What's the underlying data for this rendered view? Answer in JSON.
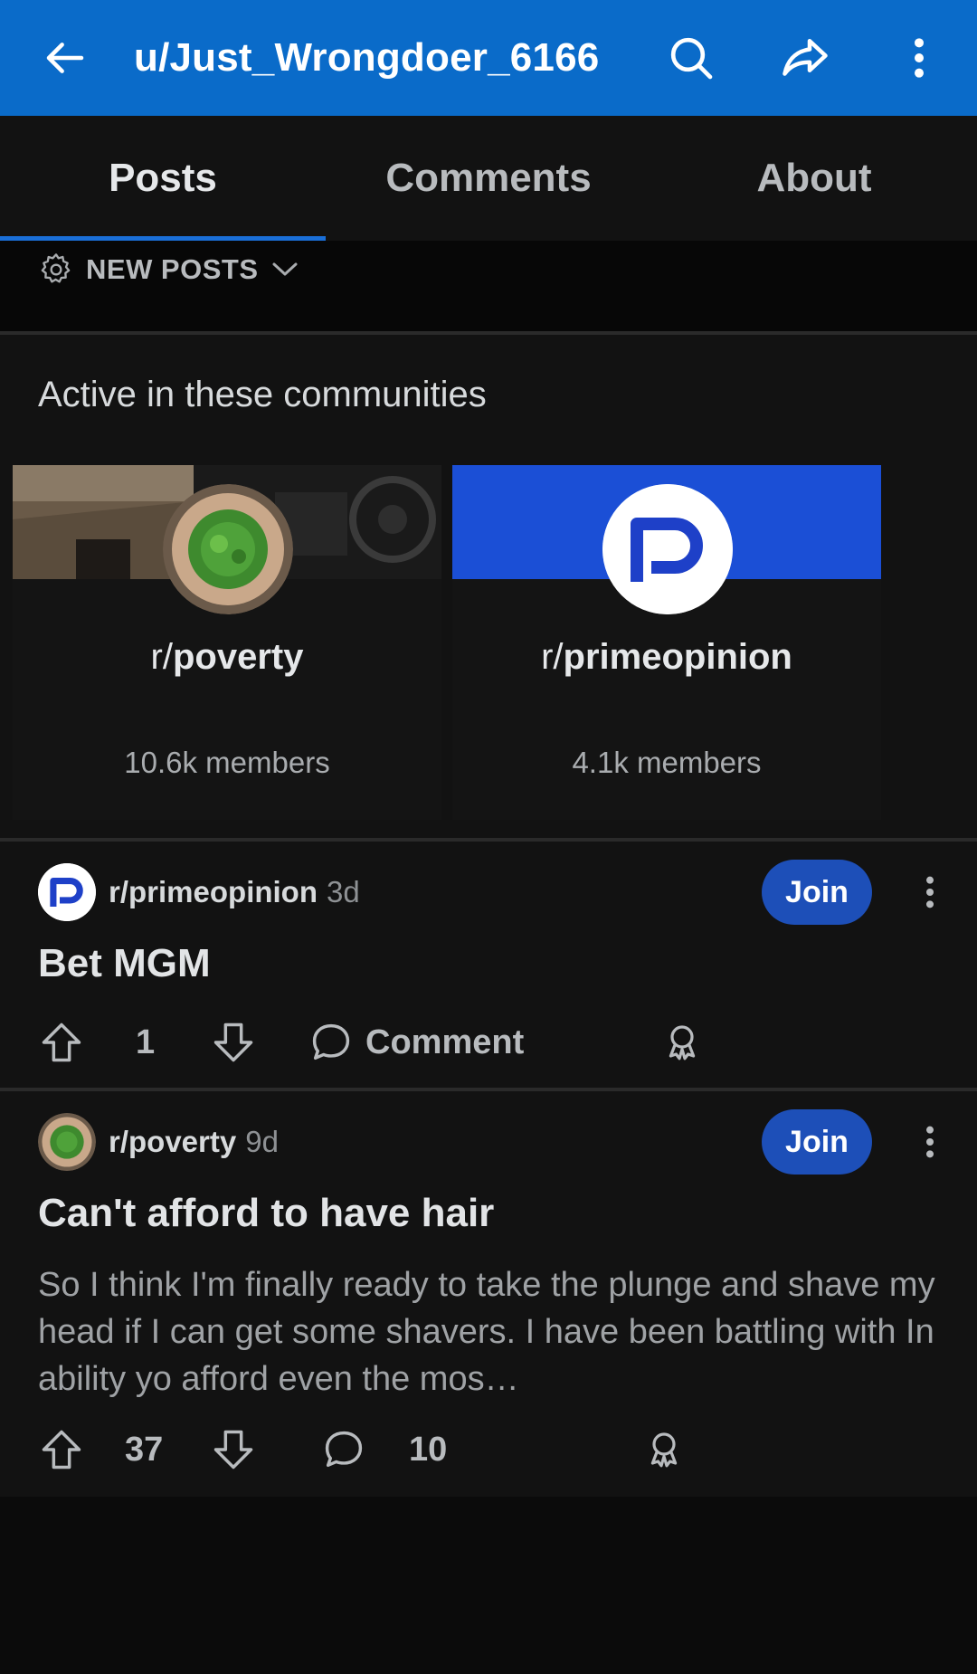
{
  "header": {
    "title": "u/Just_Wrongdoer_6166",
    "back_icon": "arrow-left-icon",
    "search_icon": "search-icon",
    "share_icon": "share-icon",
    "more_icon": "more-vertical-icon",
    "bg_color": "#0a6bc9"
  },
  "tabs": [
    {
      "label": "Posts",
      "active": true
    },
    {
      "label": "Comments",
      "active": false
    },
    {
      "label": "About",
      "active": false
    }
  ],
  "sort": {
    "label": "NEW POSTS",
    "icon": "gear-icon"
  },
  "communities": {
    "heading": "Active in these communities",
    "items": [
      {
        "prefix": "r/",
        "name": "poverty",
        "members": "10.6k members"
      },
      {
        "prefix": "r/",
        "name": "primeopinion",
        "members": "4.1k members"
      }
    ]
  },
  "posts": [
    {
      "subreddit": "r/primeopinion",
      "age": "3d",
      "join_label": "Join",
      "title": "Bet MGM",
      "body": "",
      "score": "1",
      "comments": "Comment"
    },
    {
      "subreddit": "r/poverty",
      "age": "9d",
      "join_label": "Join",
      "title": "Can't afford to have hair",
      "body": "So I think I'm finally ready to take the plunge and shave my head if I can get some shavers. I have been battling with In ability yo afford even the mos…",
      "score": "37",
      "comments": "10"
    }
  ],
  "colors": {
    "accent": "#1a6fd8",
    "join": "#1d4fb8",
    "primeopinion_banner": "#1b4fd6"
  }
}
